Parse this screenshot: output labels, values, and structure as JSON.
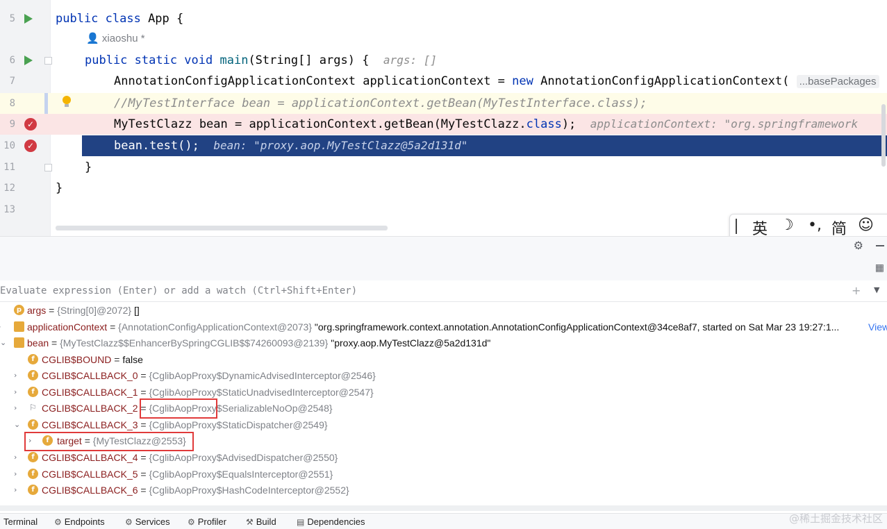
{
  "editor": {
    "author": "xiaoshu *",
    "lines": [
      {
        "num": "5"
      },
      {
        "num": "6"
      },
      {
        "num": "7"
      },
      {
        "num": "8"
      },
      {
        "num": "9"
      },
      {
        "num": "10"
      },
      {
        "num": "11"
      },
      {
        "num": "12"
      },
      {
        "num": "13"
      }
    ],
    "code": {
      "l5_kw": "public class",
      "l5_rest": " App {",
      "l6_kw": "public static void",
      "l6_m": "main",
      "l6_rest": "(String[] args) {",
      "l6_hint": "args: []",
      "l7_a": "AnnotationConfigApplicationContext applicationContext = ",
      "l7_kw": "new",
      "l7_b": " AnnotationConfigApplicationContext(",
      "l7_hint": "...basePackages",
      "l8": "//MyTestInterface bean = applicationContext.getBean(MyTestInterface.class);",
      "l9_a": "MyTestClazz bean = applicationContext.getBean(MyTestClazz.",
      "l9_kw": "class",
      "l9_b": ");",
      "l9_hint": "applicationContext: \"org.springframework",
      "l10_code": "bean.test();",
      "l10_hint": "bean: \"proxy.aop.MyTestClazz@5a2d131d\"",
      "l11": "}",
      "l12": "}"
    }
  },
  "ime": {
    "lang": "英",
    "moon": "☽",
    "punct": "•,",
    "simp": "简",
    "emoji": "☺"
  },
  "debug": {
    "eval_placeholder": "Evaluate expression (Enter) or add a watch (Ctrl+Shift+Enter)",
    "variables": [
      {
        "icon": "p",
        "name": "args",
        "type": "{String[0]@2072}",
        "value": "[]"
      },
      {
        "icon": "l",
        "name": "applicationContext",
        "type": "{AnnotationConfigApplicationContext@2073}",
        "value": "\"org.springframework.context.annotation.AnnotationConfigApplicationContext@34ce8af7, started on Sat Mar 23 19:27:1...",
        "link": "View"
      },
      {
        "icon": "l",
        "name": "bean",
        "type": "{MyTestClazz$$EnhancerBySpringCGLIB$$74260093@2139}",
        "value": "\"proxy.aop.MyTestClazz@5a2d131d\""
      },
      {
        "icon": "f",
        "name": "CGLIB$BOUND",
        "type": "",
        "value": "false"
      },
      {
        "icon": "f",
        "name": "CGLIB$CALLBACK_0",
        "type": "{CglibAopProxy$DynamicAdvisedInterceptor@2546}",
        "value": ""
      },
      {
        "icon": "f",
        "name": "CGLIB$CALLBACK_1",
        "type": "{CglibAopProxy$StaticUnadvisedInterceptor@2547}",
        "value": ""
      },
      {
        "icon": "flag",
        "name": "CGLIB$CALLBACK_2",
        "type": "{CglibAopProxy$SerializableNoOp@2548}",
        "value": ""
      },
      {
        "icon": "f",
        "name": "CGLIB$CALLBACK_3",
        "type": "{CglibAopProxy$StaticDispatcher@2549}",
        "value": ""
      },
      {
        "icon": "f",
        "name": "target",
        "type": "{MyTestClazz@2553}",
        "value": ""
      },
      {
        "icon": "f",
        "name": "CGLIB$CALLBACK_4",
        "type": "{CglibAopProxy$AdvisedDispatcher@2550}",
        "value": ""
      },
      {
        "icon": "f",
        "name": "CGLIB$CALLBACK_5",
        "type": "{CglibAopProxy$EqualsInterceptor@2551}",
        "value": ""
      },
      {
        "icon": "f",
        "name": "CGLIB$CALLBACK_6",
        "type": "{CglibAopProxy$HashCodeInterceptor@2552}",
        "value": ""
      }
    ]
  },
  "bottom_tabs": [
    {
      "label": "Terminal",
      "icon": ""
    },
    {
      "label": "Endpoints",
      "icon": "⚙"
    },
    {
      "label": "Services",
      "icon": "⚙"
    },
    {
      "label": "Profiler",
      "icon": "⚙"
    },
    {
      "label": "Build",
      "icon": "⚒"
    },
    {
      "label": "Dependencies",
      "icon": "▤"
    }
  ],
  "watermark": "@稀土掘金技术社区",
  "colors": {
    "selection": "#214283",
    "breakpoint_line": "#fbe5e5",
    "current_line": "#fefce8",
    "breakpoint": "#d13a43"
  }
}
